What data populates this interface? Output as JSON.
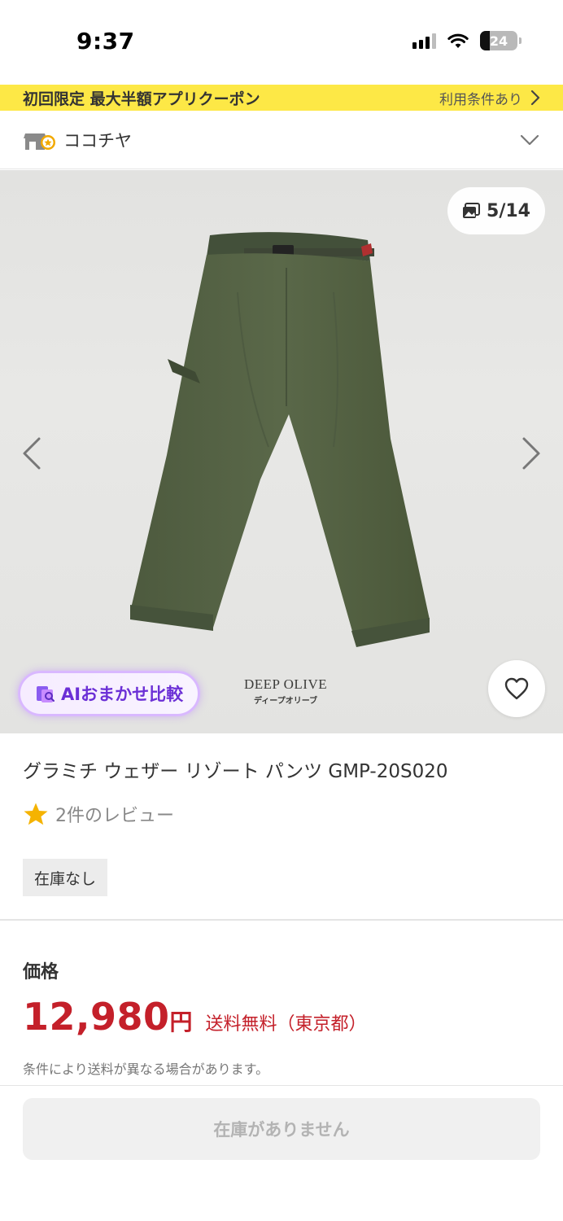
{
  "status_bar": {
    "time": "9:37",
    "battery_level": "24",
    "icons": [
      "cellular-signal-icon",
      "wifi-icon",
      "battery-icon"
    ]
  },
  "coupon_banner": {
    "title": "初回限定 最大半額アプリクーポン",
    "terms_label": "利用条件あり",
    "background_color": "#fde846"
  },
  "shop": {
    "name": "ココチヤ",
    "icon": "store-badge-icon"
  },
  "product_image": {
    "counter": "5/14",
    "ai_compare_label": "AIおまかせ比較",
    "watermark_en": "DEEP OLIVE",
    "watermark_jp": "ディープオリーブ",
    "icons": [
      "gallery-icon",
      "chevron-left-icon",
      "chevron-right-icon",
      "ai-compare-icon",
      "heart-icon"
    ]
  },
  "product": {
    "title": "グラミチ ウェザー リゾート パンツ GMP-20S020",
    "reviews_text": "2件のレビュー",
    "stock_status": "在庫なし"
  },
  "price": {
    "label": "価格",
    "value": "12,980",
    "currency": "円",
    "shipping": "送料無料（東京都）",
    "shipping_note": "条件により送料が異なる場合があります。",
    "accent_color": "#c4202a"
  },
  "cta": {
    "label": "在庫がありません"
  }
}
